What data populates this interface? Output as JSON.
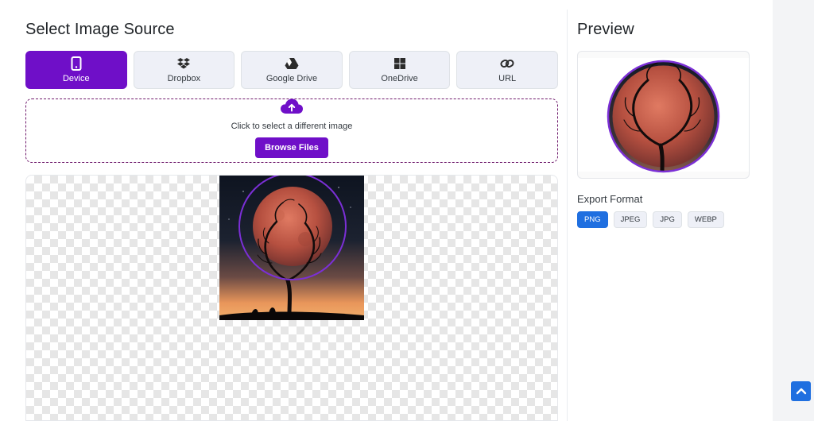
{
  "left_panel": {
    "title": "Select Image Source",
    "tabs": [
      {
        "label": "Device",
        "icon": "mobile-phone-icon",
        "active": true
      },
      {
        "label": "Dropbox",
        "icon": "dropbox-icon",
        "active": false
      },
      {
        "label": "Google Drive",
        "icon": "google-drive-icon",
        "active": false
      },
      {
        "label": "OneDrive",
        "icon": "onedrive-icon",
        "active": false
      },
      {
        "label": "URL",
        "icon": "link-icon",
        "active": false
      }
    ],
    "dropzone": {
      "icon": "cloud-upload-icon",
      "text": "Click to select a different image",
      "button_label": "Browse Files"
    }
  },
  "right_panel": {
    "title": "Preview",
    "export_format_label": "Export Format",
    "formats": [
      {
        "label": "PNG",
        "active": true
      },
      {
        "label": "JPEG",
        "active": false
      },
      {
        "label": "JPG",
        "active": false
      },
      {
        "label": "WEBP",
        "active": false
      }
    ]
  },
  "scroll_top": {
    "icon": "chevron-up-icon"
  },
  "colors": {
    "accent_purple": "#6f0fc8",
    "accent_blue": "#1f6fe0",
    "crop_circle": "#7b2fd6"
  }
}
